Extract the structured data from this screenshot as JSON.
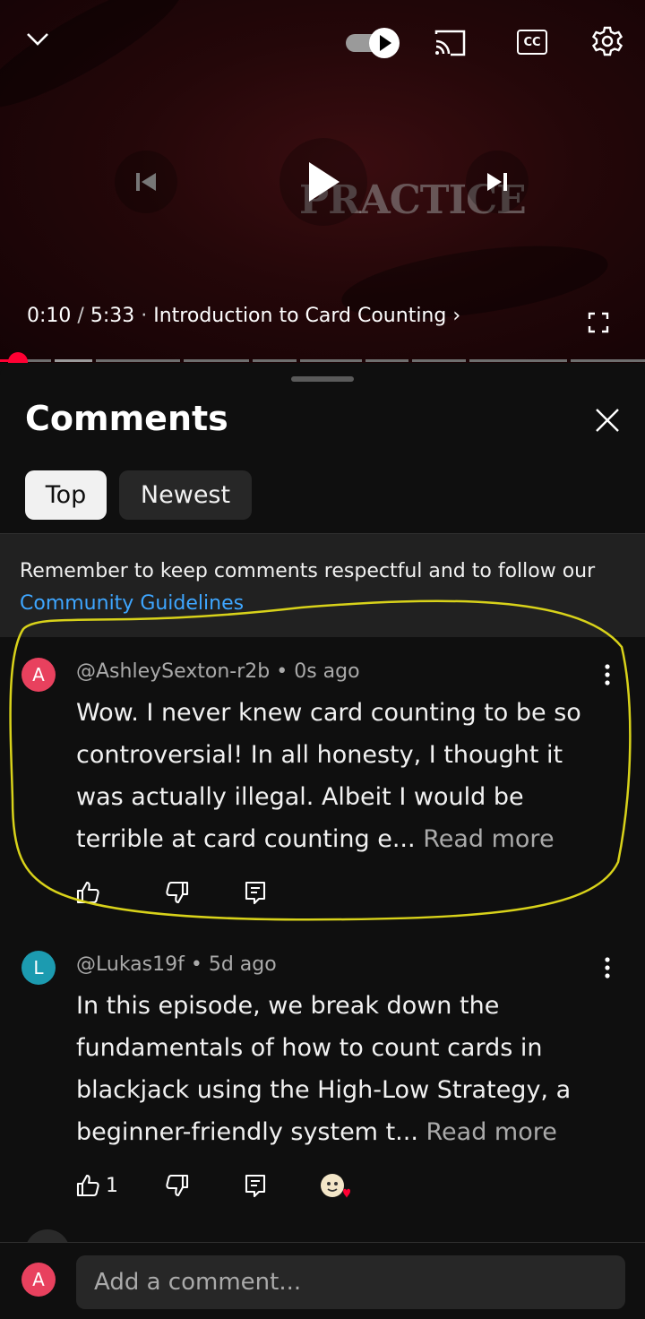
{
  "player": {
    "watermark": "PRACTICE",
    "current_time": "0:10",
    "time_separator": "/",
    "duration": "5:33",
    "chapter_dot": "·",
    "chapter_title": "Introduction to Card Counting",
    "chapter_chevron": "›",
    "progress_fraction": 0.03,
    "icons": [
      "chevron-down-icon",
      "autoplay-toggle",
      "cast-icon",
      "captions-icon",
      "gear-icon",
      "previous-icon",
      "play-icon",
      "next-icon",
      "fullscreen-icon"
    ],
    "captions_label": "CC"
  },
  "comments_panel": {
    "title": "Comments",
    "filters": [
      {
        "label": "Top",
        "selected": true
      },
      {
        "label": "Newest",
        "selected": false
      }
    ],
    "notice": {
      "text": "Remember to keep comments respectful and to follow our ",
      "link": "Community Guidelines"
    },
    "comments": [
      {
        "avatar_letter": "A",
        "avatar_color": "#e8415e",
        "author": "@AshleySexton-r2b",
        "dot": "•",
        "time": "0s ago",
        "text": "Wow. I never knew card counting to be so controversial! In all honesty, I thought it was actually illegal.  Albeit I would be terrible at card counting e...",
        "read_more": "Read more",
        "likes": "",
        "highlighted": true
      },
      {
        "avatar_letter": "L",
        "avatar_color": "#1c9bb0",
        "author": "@Lukas19f",
        "dot": "•",
        "time": "5d ago",
        "text": "In this episode, we break down the fundamentals of how to count cards in blackjack using the High-Low Strategy, a beginner-friendly system t...",
        "read_more": "Read more",
        "likes": "1",
        "highlighted": false
      }
    ],
    "compose": {
      "avatar_letter": "A",
      "avatar_color": "#e8415e",
      "placeholder": "Add a comment..."
    }
  },
  "colors": {
    "accent_red": "#ff0033",
    "link_blue": "#3ea6ff",
    "highlight_yellow": "#d8d21a"
  }
}
